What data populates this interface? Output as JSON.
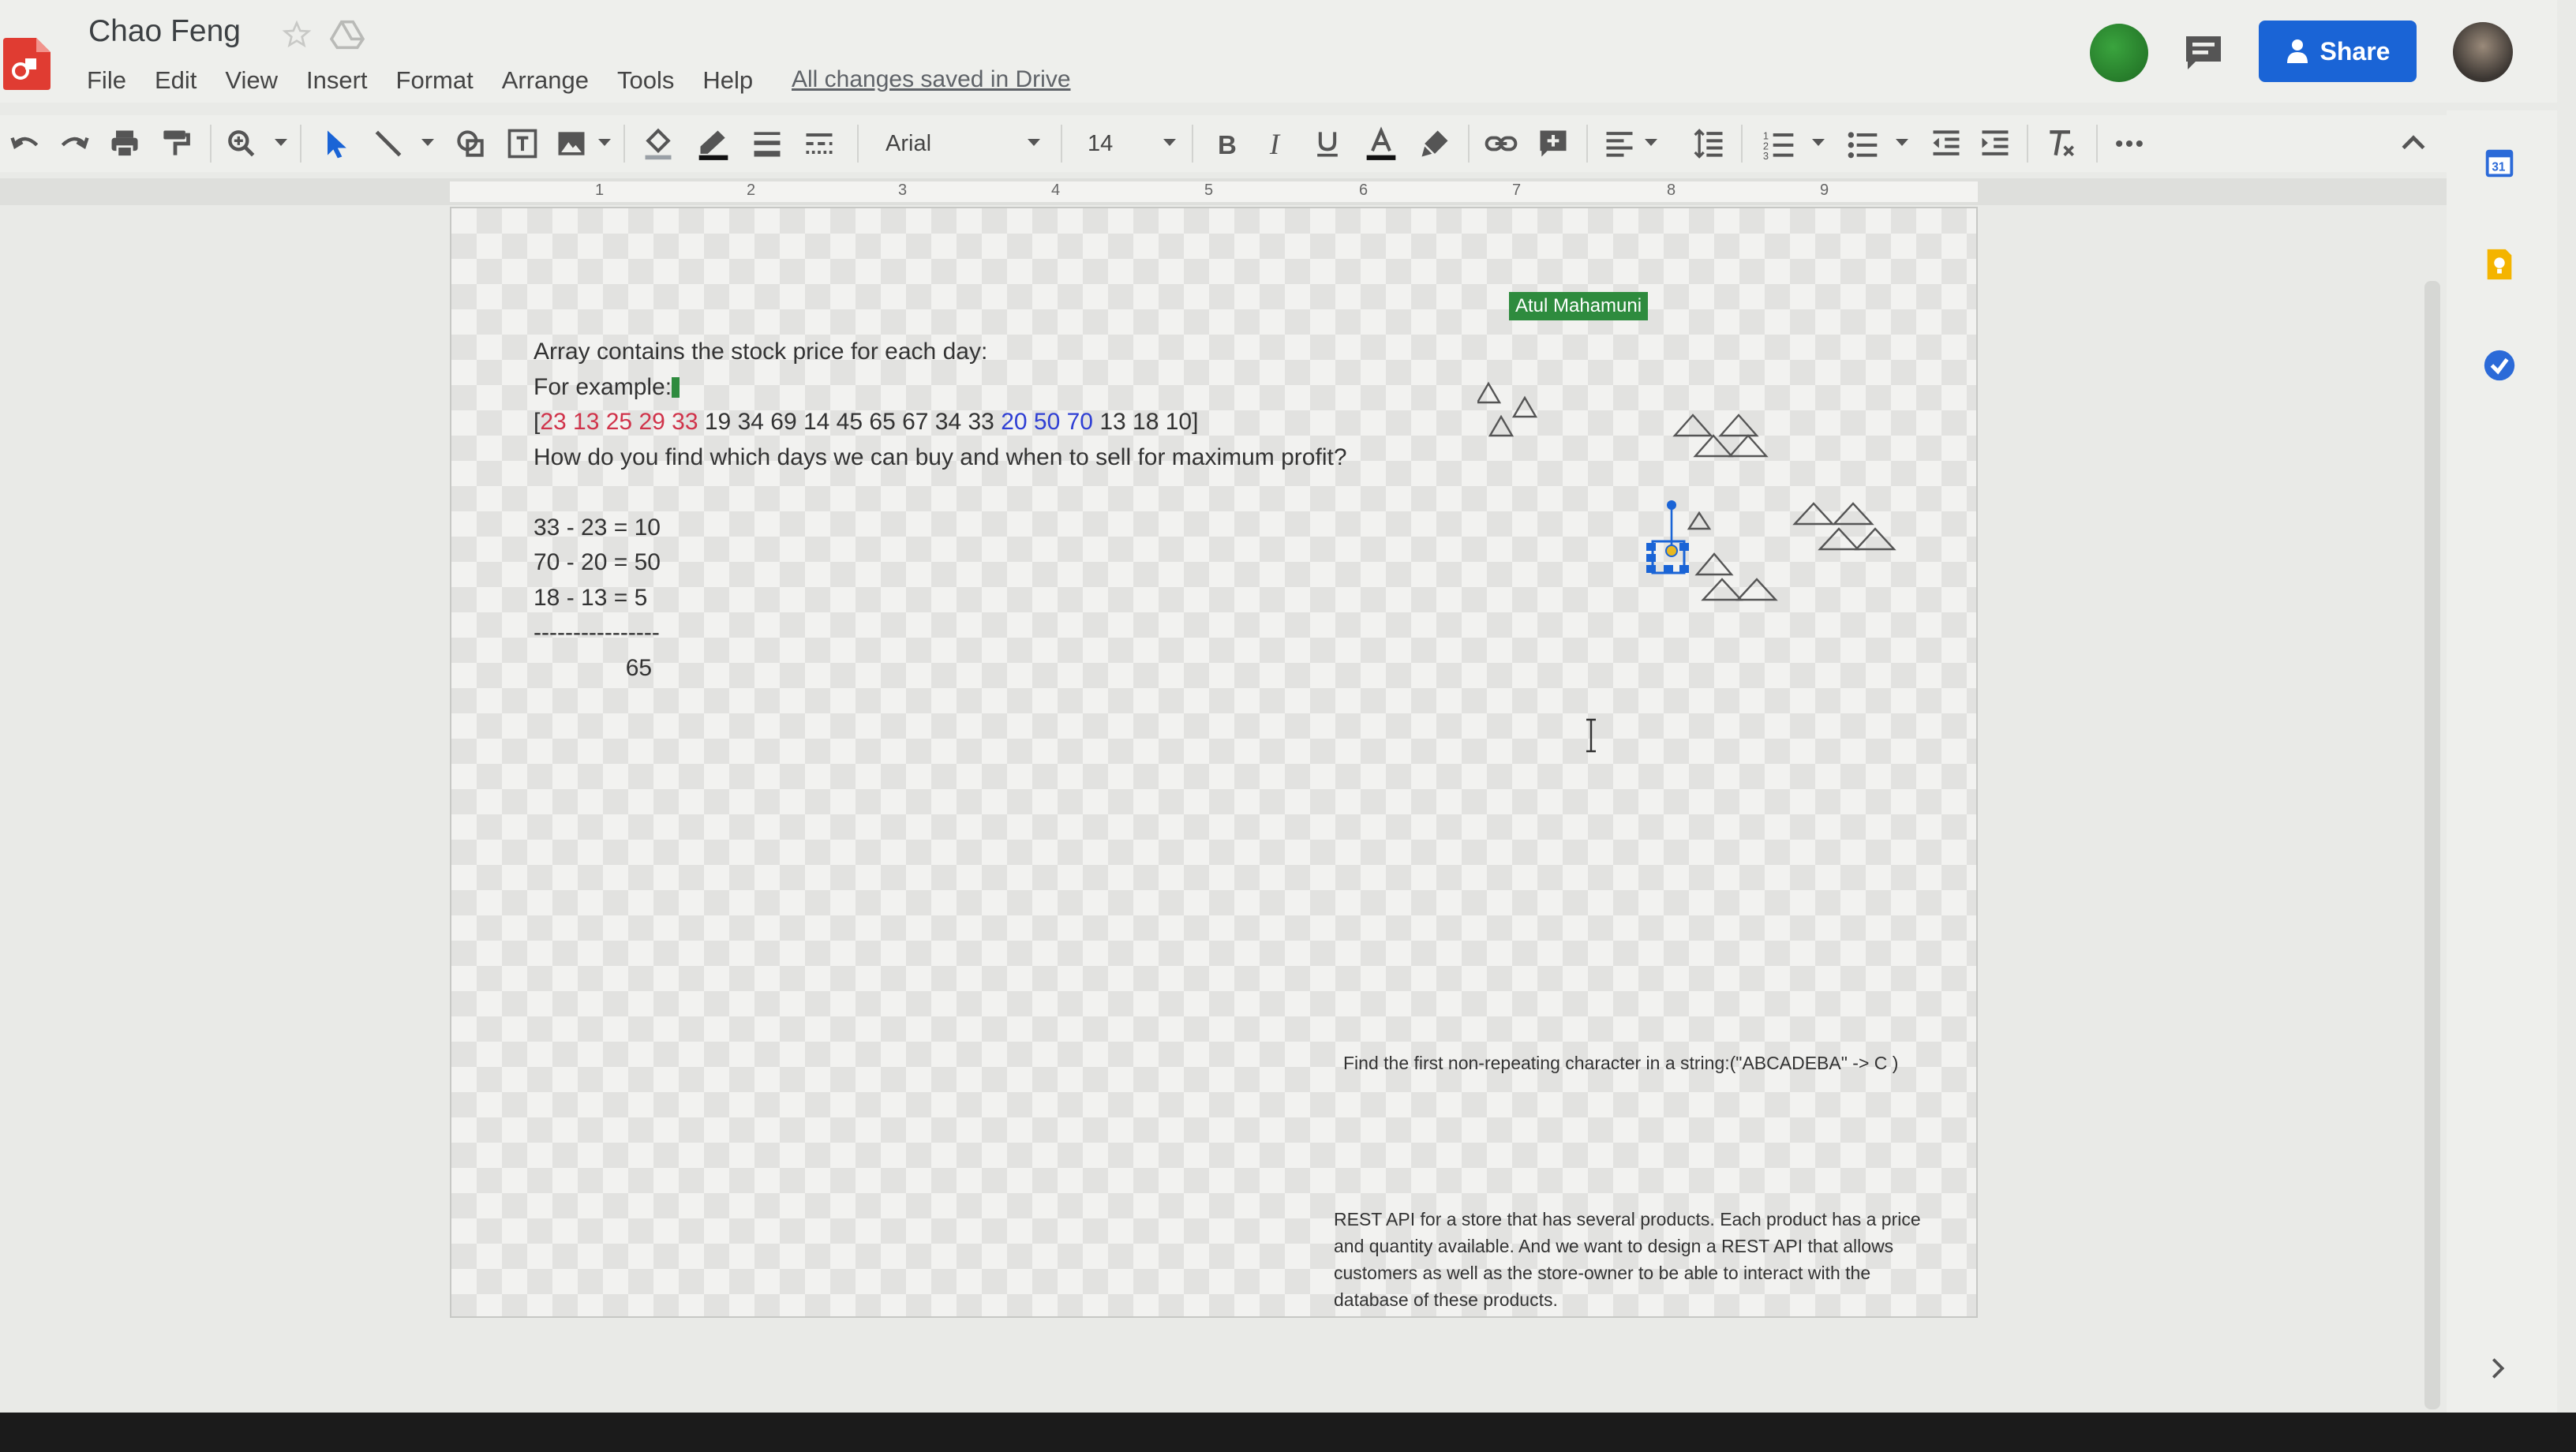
{
  "header": {
    "title": "Chao Feng",
    "save_status": "All changes saved in Drive",
    "share_label": "Share",
    "menu": [
      "File",
      "Edit",
      "View",
      "Insert",
      "Format",
      "Arrange",
      "Tools",
      "Help"
    ]
  },
  "toolbar": {
    "font": "Arial",
    "font_size": "14"
  },
  "ruler": [
    "1",
    "2",
    "3",
    "4",
    "5",
    "6",
    "7",
    "8",
    "9"
  ],
  "slide": {
    "collaborator_tag": "Atul Mahamuni",
    "lines": {
      "l1": "Array contains the stock price for each day:",
      "l2": "For example:",
      "l3_open": "[",
      "l3_red": "23 13 25 29 33",
      "l3_mid": " 19 34 69 14 45 65 67 34 33 ",
      "l3_blue": "20 50 70",
      "l3_end": " 13 18 10]",
      "l4": "How do you find which days we can buy and when to sell for maximum profit?",
      "l6": "33 - 23 = 10",
      "l7": "70 - 20 = 50",
      "l8": "18 - 13 = 5",
      "l9": "----------------",
      "l10": "              65"
    },
    "note_string": "Find the first non-repeating character in a string:(\"ABCADEBA\" -> C )",
    "note_api": "REST API for a store that has several products. Each product has a price and quantity available. And we want to design a REST API that allows customers as well as the store-owner to be able to interact with the database of these products."
  },
  "colors": {
    "share_button": "#1a64d6",
    "highlight_red": "#d0334a",
    "highlight_blue": "#2f3fd4",
    "collaborator": "#2e8b3e"
  },
  "icons": [
    "undo-icon",
    "redo-icon",
    "print-icon",
    "paint-format-icon",
    "zoom-icon",
    "select-icon",
    "line-icon",
    "shape-icon",
    "textbox-icon",
    "image-icon",
    "fill-color-icon",
    "border-color-icon",
    "border-weight-icon",
    "border-dash-icon",
    "bold-icon",
    "italic-icon",
    "underline-icon",
    "text-color-icon",
    "highlight-icon",
    "link-icon",
    "comment-add-icon",
    "align-icon",
    "line-spacing-icon",
    "numbered-list-icon",
    "bulleted-list-icon",
    "indent-decrease-icon",
    "indent-increase-icon",
    "clear-formatting-icon",
    "more-icon",
    "collapse-icon",
    "calendar-icon",
    "keep-icon",
    "tasks-icon"
  ]
}
